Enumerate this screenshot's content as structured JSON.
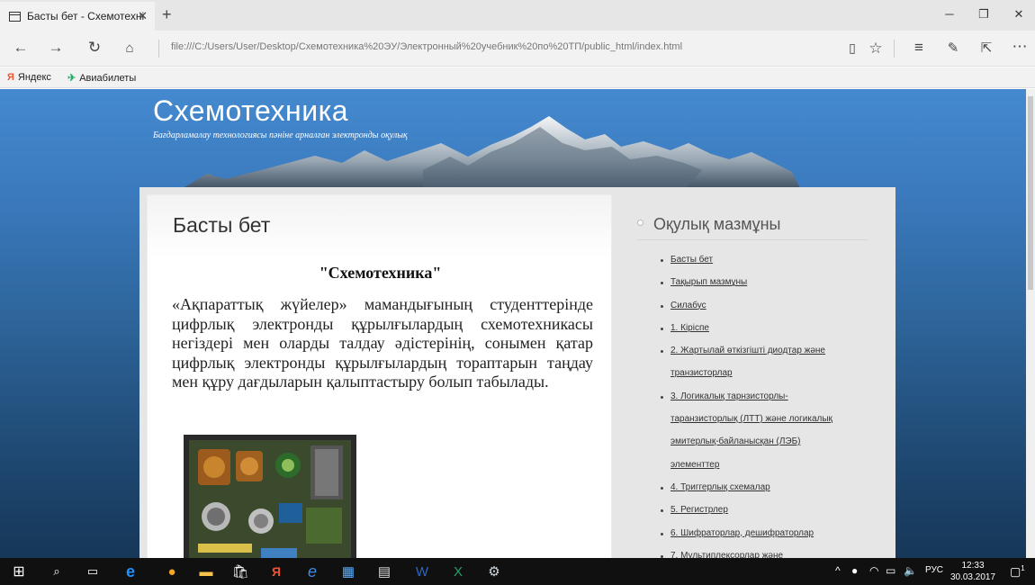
{
  "browser": {
    "tab_title": "Басты бет - Схемотехні",
    "tab_close": "✕",
    "new_tab": "+",
    "url": "file:///C:/Users/User/Desktop/Схемотехника%20ЭУ/Электронный%20учебник%20по%20ТП/public_html/index.html",
    "favorites": [
      {
        "label": "Яндекс",
        "icon": "yandex-icon"
      },
      {
        "label": "Авиабилеты",
        "icon": "airplane-icon"
      }
    ]
  },
  "site": {
    "title": "Схемотехника",
    "subtitle": "Бағдарламалау технологиясы пәніне арналған электронды оқулық"
  },
  "content": {
    "page_title": "Басты бет",
    "heading": "\"Схемотехника\"",
    "body": "«Ақпараттық жүйелер» мамандығының студенттерінде цифрлық электронды құрылғылардың схемотехникасы негіздері мен оларды талдау әдістерінің, сонымен қатар цифрлық электронды құрылғылардың тораптарын таңдау мен құру дағдыларын қалыптастыру болып табылады."
  },
  "sidebar": {
    "title": "Оқулық мазмұны",
    "items": [
      "Басты бет",
      "Тақырып мазмұны",
      "Силабус",
      "1. Кіріспе",
      "2. Жартылай өткізгішті диодтар және",
      "транзисторлар",
      "3. Логикалық тарнзисторлы-",
      "таранзисторлық (ЛТТ) және логикалық",
      "эмитерлық-байланысқан (ЛЭБ)",
      "элементтер",
      "4. Триггерлық схемалар",
      "5. Регистрлер",
      "6. Шифраторлар, дешифраторлар",
      "7. Мультиплексорлар және"
    ]
  },
  "taskbar": {
    "lang": "РУС",
    "time": "12:33",
    "date": "30.03.2017",
    "notifications": "1"
  },
  "colors": {
    "sky_top": "#4489cf",
    "sky_bottom": "#163758",
    "taskbar": "#101010"
  }
}
